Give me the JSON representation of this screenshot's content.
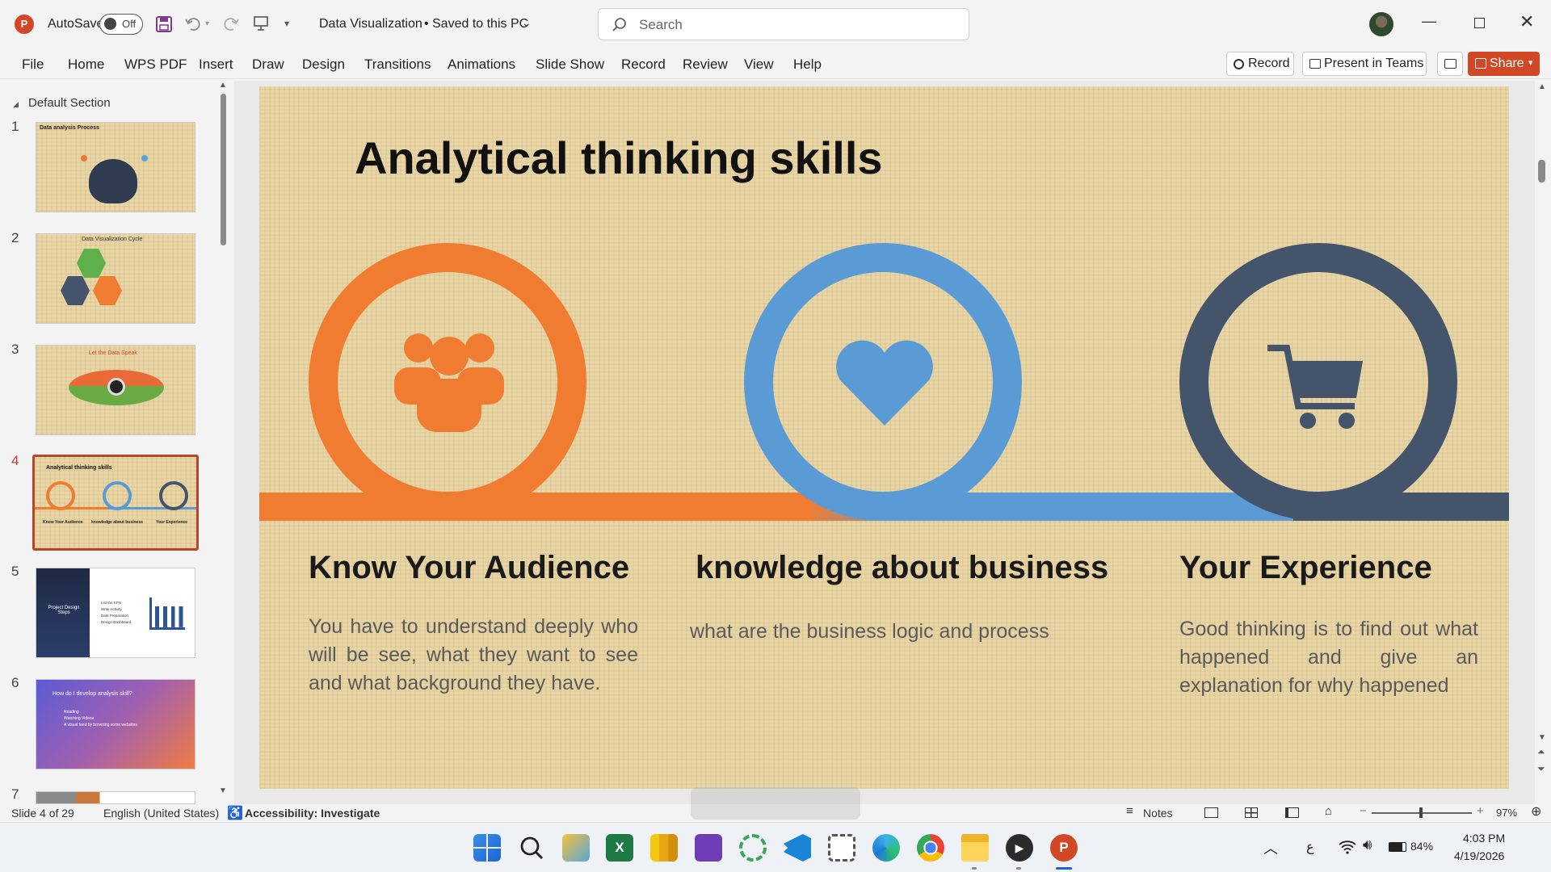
{
  "titlebar": {
    "autosave_label": "AutoSave",
    "autosave_state": "Off",
    "doc_title": "Data Visualization",
    "save_status": "Saved to this PC",
    "search_placeholder": "Search"
  },
  "menu": [
    "File",
    "Home",
    "WPS PDF",
    "Insert",
    "Draw",
    "Design",
    "Transitions",
    "Animations",
    "Slide Show",
    "Record",
    "Review",
    "View",
    "Help"
  ],
  "ribbon_buttons": {
    "record": "Record",
    "present": "Present in Teams",
    "share": "Share"
  },
  "thumbnails": {
    "section": "Default Section",
    "numbers": [
      "1",
      "2",
      "3",
      "4",
      "5",
      "6",
      "7"
    ],
    "t1_title": "Data analysis Process",
    "t2_title": "Data Visualization Cycle",
    "t3_title": "Let the Data Speak",
    "t4_title": "Analytical thinking skills",
    "t4_cols": [
      "Know Your Audience",
      "knowledge about business",
      "Your Experience"
    ],
    "t5_title": "Project Design Steps",
    "t5_items": [
      "List the KPIs",
      "Write Activity",
      "Data Preparation",
      "Design Dashboard"
    ],
    "t6_title": "How do I develop analysis  skill?",
    "t6_items": [
      "Reading",
      "Watching Videos",
      "A visual feed by browsing some websites"
    ]
  },
  "slide": {
    "title": "Analytical thinking skills",
    "col1_heading": "Know Your Audience",
    "col1_body": "You have to understand deeply who will be see, what they want to see and what background they have.",
    "col2_heading": "knowledge about business",
    "col2_body": "what are the business logic and process",
    "col3_heading": "Your Experience",
    "col3_body": "Good thinking is to find out what happened and give an explanation  for why happened",
    "colors": {
      "orange": "#f07c31",
      "blue": "#5b9bd5",
      "navy": "#44546a"
    }
  },
  "status": {
    "slide_info": "Slide 4 of 29",
    "language": "English (United States)",
    "accessibility": "Accessibility: Investigate",
    "notes": "Notes",
    "zoom": "97%"
  },
  "taskbar": {
    "battery": "84%",
    "time": "4:03 PM",
    "date": "4/19/2026",
    "input_lang": "ع"
  }
}
